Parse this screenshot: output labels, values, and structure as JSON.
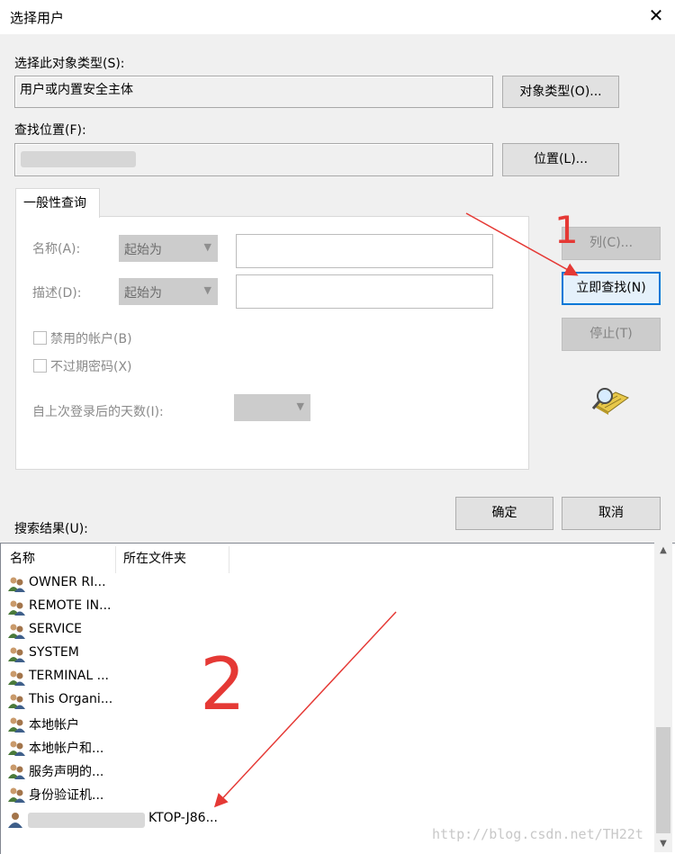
{
  "window": {
    "title": "选择用户",
    "close_glyph": "✕"
  },
  "object_type": {
    "label": "选择此对象类型(S):",
    "value": "用户或内置安全主体",
    "button": "对象类型(O)..."
  },
  "location": {
    "label": "查找位置(F):",
    "button": "位置(L)..."
  },
  "query": {
    "tab_label": "一般性查询",
    "name_label": "名称(A):",
    "name_mode": "起始为",
    "desc_label": "描述(D):",
    "desc_mode": "起始为",
    "disabled_accounts": "禁用的帐户(B)",
    "non_expiring_pw": "不过期密码(X)",
    "days_label": "自上次登录后的天数(I):"
  },
  "side_buttons": {
    "columns": "列(C)...",
    "find_now": "立即查找(N)",
    "stop": "停止(T)"
  },
  "ok_label": "确定",
  "cancel_label": "取消",
  "results": {
    "label": "搜索结果(U):",
    "columns": [
      "名称",
      "所在文件夹"
    ],
    "rows": [
      "OWNER RI...",
      "REMOTE IN...",
      "SERVICE",
      "SYSTEM",
      "TERMINAL ...",
      "This Organi...",
      "本地帐户",
      "本地帐户和...",
      "服务声明的...",
      "身份验证机..."
    ],
    "last_row_suffix": "KTOP-J86..."
  },
  "annotations": {
    "mark1": "1",
    "mark2": "2"
  },
  "watermark": "http://blog.csdn.net/TH22t",
  "colors": {
    "accent": "#0078d7",
    "arrow": "#e53935",
    "disabled_button": "#cccccc"
  },
  "icons": {
    "close": "close-icon",
    "user_group": "user-group-icon",
    "search_directory": "search-directory-icon",
    "dropdown": "chevron-down-icon"
  }
}
